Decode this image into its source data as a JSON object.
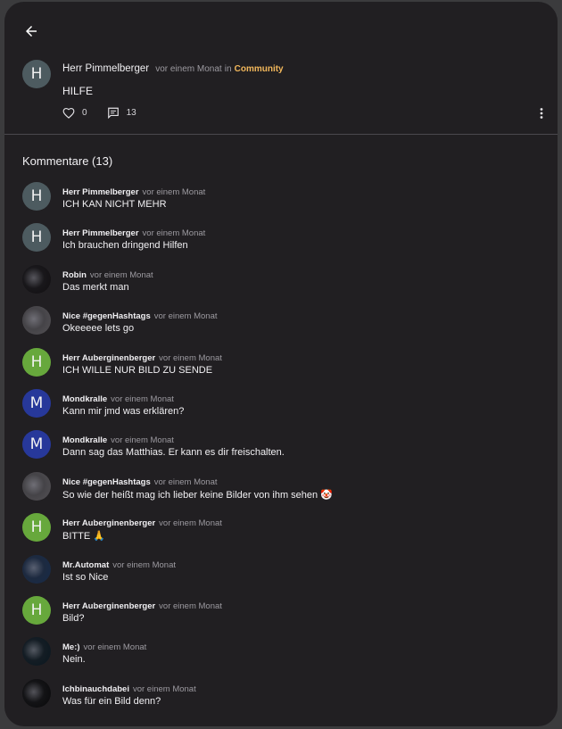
{
  "post": {
    "author": "Herr Pimmelberger",
    "avatar_letter": "H",
    "time": "vor einem Monat",
    "in_word": "in",
    "community": "Community",
    "body": "HILFE",
    "likes": "0",
    "comments": "13"
  },
  "comments_section": {
    "title": "Kommentare (13)"
  },
  "comments": [
    {
      "author": "Herr Pimmelberger",
      "time": "vor einem Monat",
      "text": "ICH KAN NICHT MEHR",
      "avatar_letter": "H",
      "avatar_color": "#4d5b60"
    },
    {
      "author": "Herr Pimmelberger",
      "time": "vor einem Monat",
      "text": "Ich brauchen dringend Hilfen",
      "avatar_letter": "H",
      "avatar_color": "#4d5b60"
    },
    {
      "author": "Robin",
      "time": "vor einem Monat",
      "text": "Das merkt man",
      "avatar_letter": "",
      "avatar_color": "#151316"
    },
    {
      "author": "Nice #gegenHashtags",
      "time": "vor einem Monat",
      "text": "Okeeeee lets go",
      "avatar_letter": "",
      "avatar_color": "#4c4a4e"
    },
    {
      "author": "Herr Auberginenberger",
      "time": "vor einem Monat",
      "text": "ICH WILLE NUR BILD ZU SENDE",
      "avatar_letter": "H",
      "avatar_color": "#67a83c"
    },
    {
      "author": "Mondkralle",
      "time": "vor einem Monat",
      "text": "Kann mir jmd was erklären?",
      "avatar_letter": "M",
      "avatar_color": "#27389a"
    },
    {
      "author": "Mondkralle",
      "time": "vor einem Monat",
      "text": "Dann sag das Matthias. Er kann es dir freischalten.",
      "avatar_letter": "M",
      "avatar_color": "#27389a"
    },
    {
      "author": "Nice #gegenHashtags",
      "time": "vor einem Monat",
      "text": "So wie der heißt mag ich lieber keine Bilder von ihm sehen 🤡",
      "avatar_letter": "",
      "avatar_color": "#4c4a4e"
    },
    {
      "author": "Herr Auberginenberger",
      "time": "vor einem Monat",
      "text": "BITTE 🙏",
      "avatar_letter": "H",
      "avatar_color": "#67a83c"
    },
    {
      "author": "Mr.Automat",
      "time": "vor einem Monat",
      "text": "Ist so Nice",
      "avatar_letter": "",
      "avatar_color": "#1a2a44"
    },
    {
      "author": "Herr Auberginenberger",
      "time": "vor einem Monat",
      "text": "Bild?",
      "avatar_letter": "H",
      "avatar_color": "#67a83c"
    },
    {
      "author": "Me:)",
      "time": "vor einem Monat",
      "text": "Nein.",
      "avatar_letter": "",
      "avatar_color": "#0f1a22"
    },
    {
      "author": "Ichbinauchdabei",
      "time": "vor einem Monat",
      "text": "Was für ein Bild denn?",
      "avatar_letter": "",
      "avatar_color": "#0e0e10"
    }
  ],
  "colors": {
    "background": "#211f22",
    "accent_community": "#f2b75b",
    "muted_text": "#9c9aa0"
  },
  "icons": {
    "back": "arrow-left-icon",
    "like": "heart-outline-icon",
    "comment": "comment-icon",
    "more": "kebab-menu-icon"
  }
}
